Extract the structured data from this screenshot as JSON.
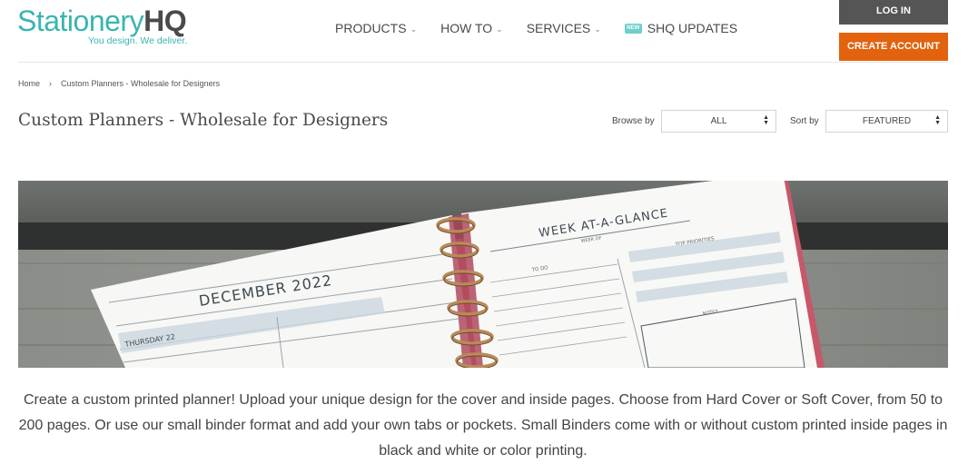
{
  "logo": {
    "main": "Stationery",
    "bold": "HQ",
    "tagline": "You design. We deliver."
  },
  "nav": {
    "items": [
      {
        "label": "PRODUCTS"
      },
      {
        "label": "HOW TO"
      },
      {
        "label": "SERVICES"
      },
      {
        "label": "SHQ UPDATES",
        "badge": "NEW"
      }
    ]
  },
  "account": {
    "login": "LOG IN",
    "create": "CREATE ACCOUNT"
  },
  "breadcrumb": {
    "home": "Home",
    "separator": "›",
    "current": "Custom Planners - Wholesale for Designers"
  },
  "page": {
    "title": "Custom Planners - Wholesale for Designers"
  },
  "filters": {
    "browse_label": "Browse by",
    "browse_value": "ALL",
    "sort_label": "Sort by",
    "sort_value": "FEATURED"
  },
  "banner": {
    "left_heading": "DECEMBER 2022",
    "left_day": "THURSDAY 22",
    "right_heading": "WEEK AT-A-GLANCE",
    "right_week": "WEEK OF",
    "right_todo": "TO DO",
    "right_priorities": "TOP PRIORITIES",
    "right_notes": "NOTES"
  },
  "description": "Create a custom printed planner! Upload your unique design for the cover and inside pages. Choose from Hard Cover or Soft Cover, from 50 to 200 pages. Or use our small binder format and add your own tabs or pockets. Small Binders come with or without custom printed inside pages in black and white or color printing.",
  "colors": {
    "brand_teal": "#3ab5b0",
    "accent_orange": "#e2620e",
    "login_gray": "#555555"
  }
}
